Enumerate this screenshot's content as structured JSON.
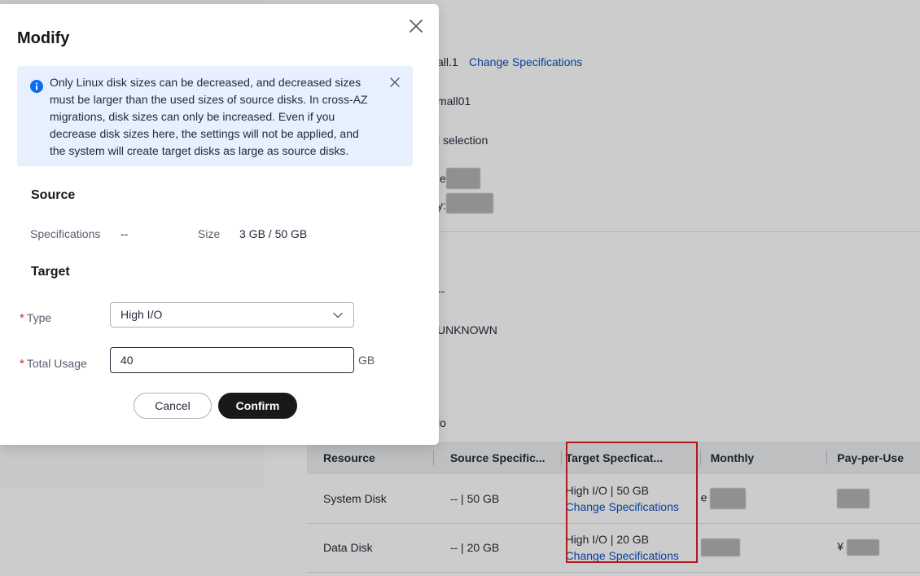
{
  "background": {
    "spec_line": "all.1",
    "change_spec_link": "Change Specifications",
    "flavor_line": "mall01",
    "selection_line": "l selection",
    "ip_fragment": "e",
    "key_fragment": "y:",
    "dash_line": "--",
    "status_line": "UNKNOWN",
    "io_fragment": "lo",
    "table": {
      "headers": [
        "Resource",
        "Source Specific...",
        "Target Specficat...",
        "Monthly",
        "Pay-per-Use"
      ],
      "rows": [
        {
          "resource": "System Disk",
          "source": "-- | 50 GB",
          "target": "High I/O | 50 GB",
          "target_link": "Change Specifications",
          "monthly_prefix": "e",
          "ppu_prefix": ""
        },
        {
          "resource": "Data Disk",
          "source": "-- | 20 GB",
          "target": "High I/O | 20 GB",
          "target_link": "Change Specifications",
          "monthly_prefix": "",
          "ppu_prefix": "¥"
        }
      ]
    }
  },
  "modal": {
    "title": "Modify",
    "info_message": "Only Linux disk sizes can be decreased, and decreased sizes must be larger than the used sizes of source disks. In cross-AZ migrations, disk sizes can only be increased. Even if you decrease disk sizes here, the settings will not be applied, and the system will create target disks as large as source disks.",
    "source": {
      "title": "Source",
      "spec_label": "Specifications",
      "spec_value": "--",
      "size_label": "Size",
      "size_value": "3 GB / 50 GB"
    },
    "target": {
      "title": "Target",
      "type_label": "Type",
      "type_value": "High I/O",
      "usage_label": "Total Usage",
      "usage_value": "40",
      "usage_unit": "GB",
      "required_mark": "*"
    },
    "buttons": {
      "cancel": "Cancel",
      "confirm": "Confirm"
    }
  },
  "colors": {
    "link": "#0a52c4",
    "info_bg": "#e6f0ff",
    "info_icon": "#0a6cf0",
    "required": "#e02020",
    "highlight": "#e02020",
    "confirm_bg": "#191919"
  }
}
